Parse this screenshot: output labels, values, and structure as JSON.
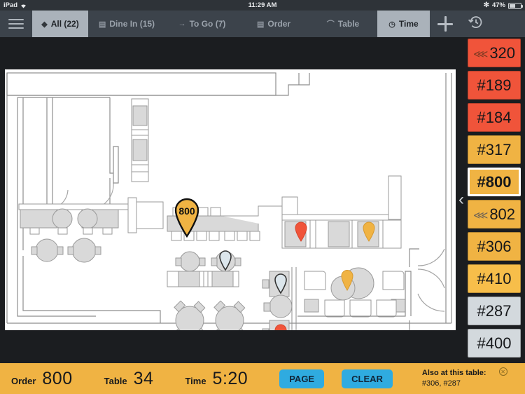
{
  "status_bar": {
    "device": "iPad",
    "wifi_icon": "wifi-icon",
    "time": "11:29 AM",
    "bluetooth_icon": "bluetooth-icon",
    "battery_percent": "47%",
    "battery_icon": "battery-icon"
  },
  "tabbar": {
    "menu_icon": "hamburger-menu-icon",
    "tabs": [
      {
        "label": "All (22)",
        "icon": "diamond-icon",
        "active": true
      },
      {
        "label": "Dine In (15)",
        "icon": "building-icon",
        "active": false
      },
      {
        "label": "To Go (7)",
        "icon": "arrow-right-icon",
        "active": false
      },
      {
        "label": "Order",
        "icon": "list-icon",
        "active": false
      },
      {
        "label": "Table",
        "icon": "table-icon",
        "active": false
      },
      {
        "label": "Time",
        "icon": "clock-icon",
        "active": true
      }
    ],
    "add_icon": "plus-icon",
    "history_icon": "history-clock-icon"
  },
  "floorplan": {
    "collapse_icon": "chevron-left-icon",
    "selected_pin_label": "800",
    "pins": [
      {
        "label": "800",
        "color": "#F0B343",
        "type": "selected-table-pin"
      },
      {
        "color": "#F0543A",
        "type": "table-pin"
      },
      {
        "color": "#F0B343",
        "type": "table-pin"
      },
      {
        "color": "#DCE6EC",
        "type": "table-pin"
      },
      {
        "color": "#DCE6EC",
        "type": "table-pin"
      },
      {
        "color": "#DCE6EC",
        "type": "table-pin"
      },
      {
        "color": "#F0543A",
        "type": "table-pin"
      },
      {
        "color": "#F0B343",
        "type": "table-pin"
      },
      {
        "color": "#DCE6EC",
        "type": "table-pin"
      }
    ]
  },
  "order_sidebar": {
    "items": [
      {
        "label": "320",
        "prefix_icon": "rss-icon",
        "color": "#F0543A",
        "selected": false
      },
      {
        "label": "#189",
        "prefix_icon": null,
        "color": "#F0543A",
        "selected": false
      },
      {
        "label": "#184",
        "prefix_icon": null,
        "color": "#F0543A",
        "selected": false
      },
      {
        "label": "#317",
        "prefix_icon": null,
        "color": "#F0B343",
        "selected": false
      },
      {
        "label": "#800",
        "prefix_icon": null,
        "color": "#F0B343",
        "selected": true
      },
      {
        "label": "802",
        "prefix_icon": "rss-icon",
        "color": "#F0B343",
        "selected": false
      },
      {
        "label": "#306",
        "prefix_icon": null,
        "color": "#F0B343",
        "selected": false
      },
      {
        "label": "#410",
        "prefix_icon": null,
        "color": "#F7BE4A",
        "selected": false
      },
      {
        "label": "#287",
        "prefix_icon": null,
        "color": "#D3D9DD",
        "selected": false
      },
      {
        "label": "#400",
        "prefix_icon": null,
        "color": "#D3D9DD",
        "selected": false
      }
    ]
  },
  "infobar": {
    "order_label": "Order",
    "order_value": "800",
    "table_label": "Table",
    "table_value": "34",
    "time_label": "Time",
    "time_value": "5:20",
    "page_button": "PAGE",
    "clear_button": "CLEAR",
    "also_header": "Also at this table:",
    "also_values": "#306, #287",
    "close_icon": "close-circle-icon"
  }
}
